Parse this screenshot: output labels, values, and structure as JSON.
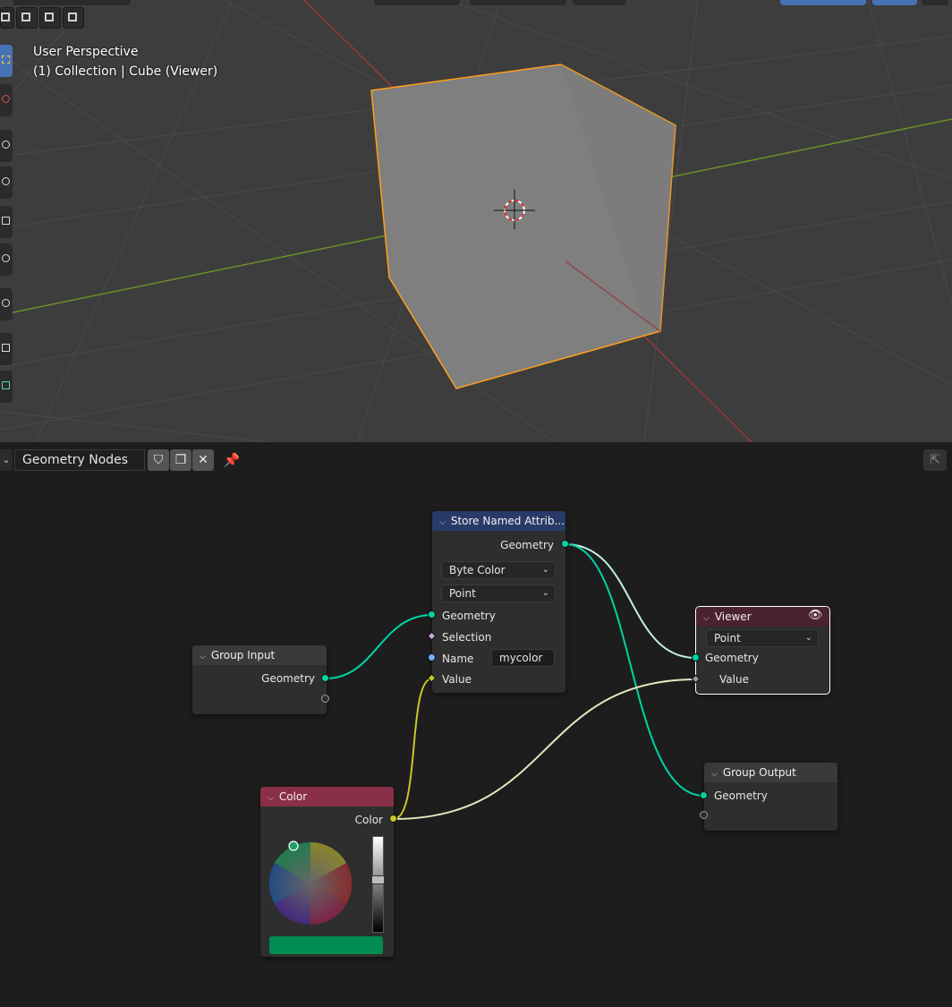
{
  "viewport": {
    "perspective_label": "User Perspective",
    "collection_label": "(1) Collection | Cube (Viewer)"
  },
  "node_editor": {
    "tree_name": "Geometry Nodes",
    "header_icons": [
      "shield-icon",
      "duplicate-icon",
      "close-icon",
      "pin-icon"
    ]
  },
  "nodes": {
    "group_input": {
      "title": "Group Input",
      "output_geometry": "Geometry"
    },
    "store_named_attribute": {
      "title": "Store Named Attrib...",
      "output_geometry": "Geometry",
      "data_type": "Byte Color",
      "domain": "Point",
      "input_geometry": "Geometry",
      "input_selection": "Selection",
      "name_label": "Name",
      "name_value": "mycolor",
      "input_value": "Value"
    },
    "viewer": {
      "title": "Viewer",
      "domain": "Point",
      "input_geometry": "Geometry",
      "input_value": "Value"
    },
    "group_output": {
      "title": "Group Output",
      "input_geometry": "Geometry"
    },
    "color": {
      "title": "Color",
      "output_color": "Color",
      "swatch_color": "#008c52"
    }
  },
  "colors": {
    "geometry_socket": "#00d6a3",
    "color_socket": "#c7c729",
    "string_socket": "#70b2ff",
    "selection_socket": "#cca6d6",
    "viewer_header": "#4a2230",
    "color_header": "#8a2f48",
    "store_header": "#283a68",
    "group_header": "#3a3a3a"
  }
}
